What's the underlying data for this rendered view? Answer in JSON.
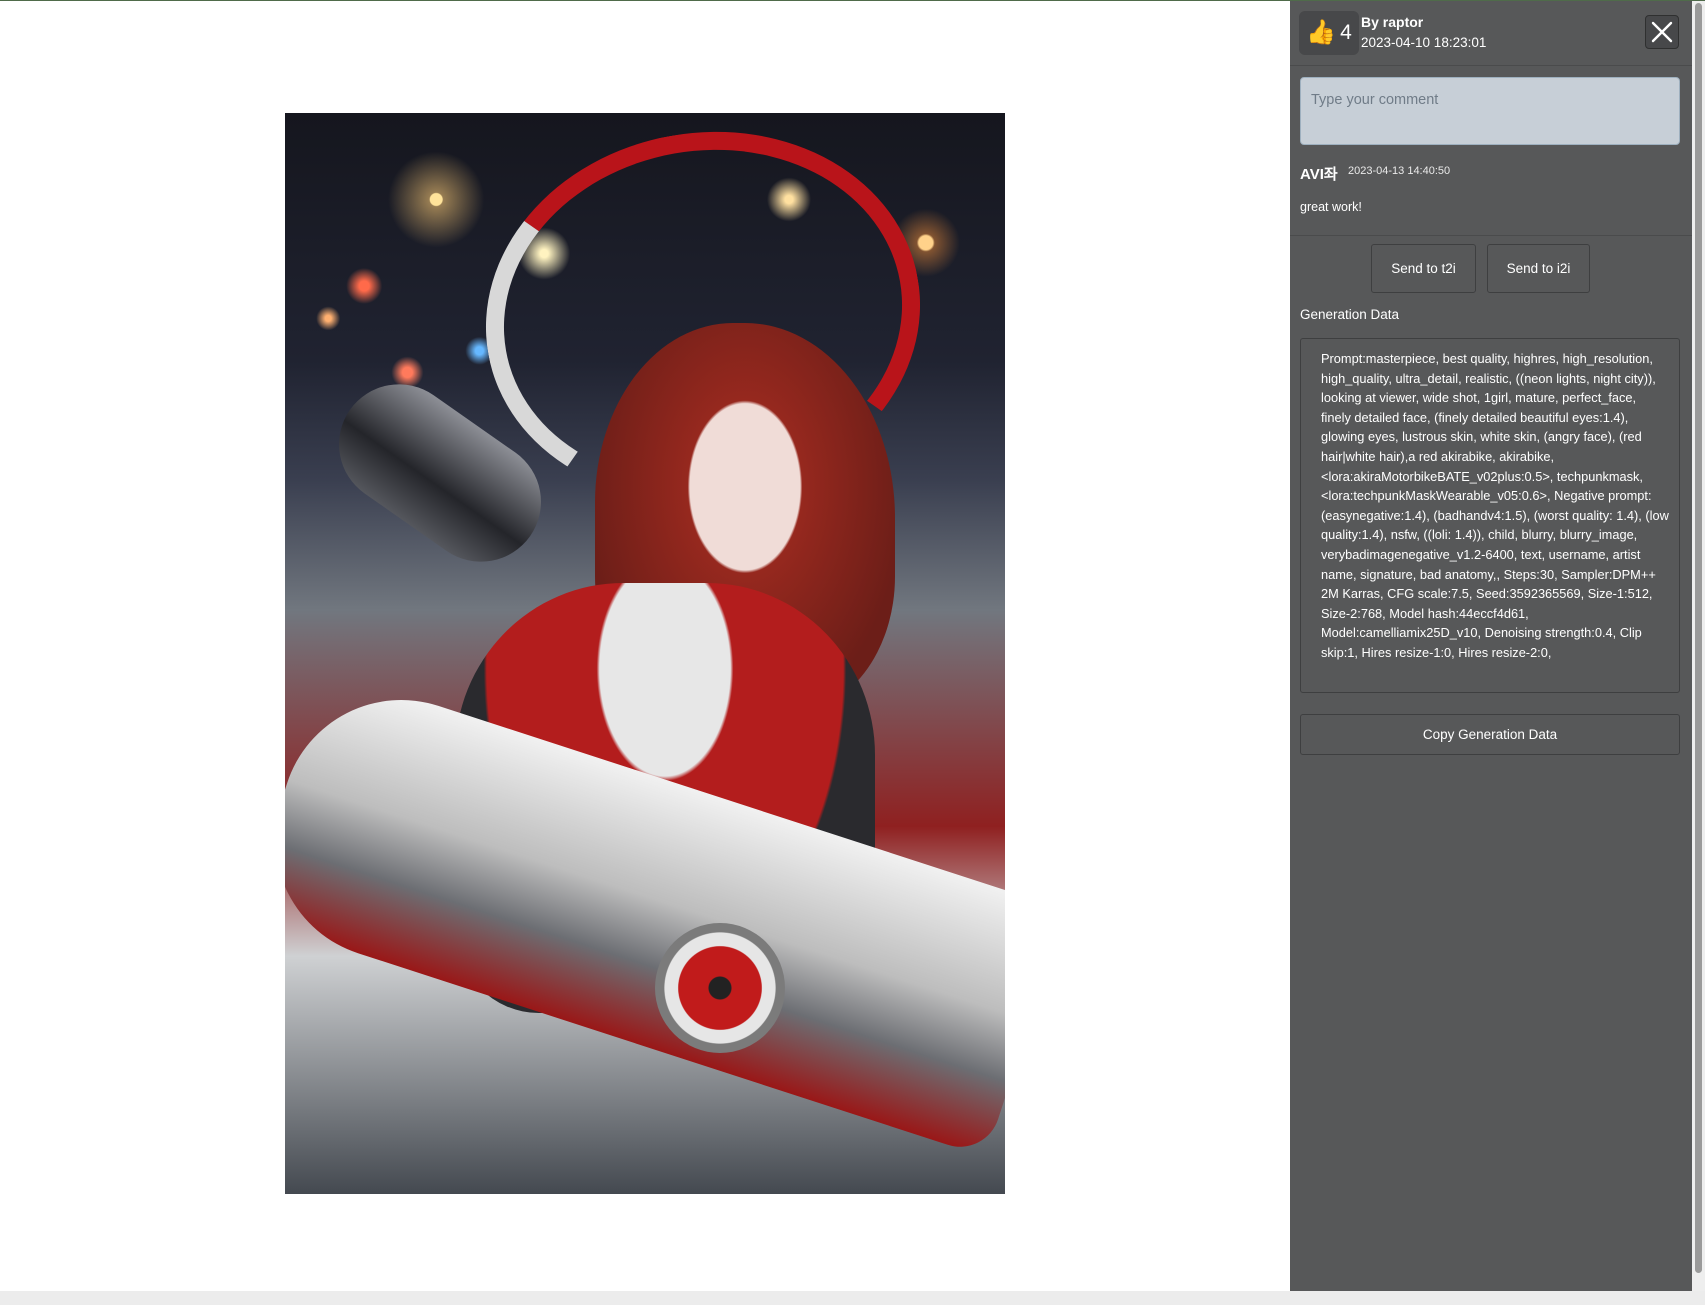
{
  "post": {
    "likes": "4",
    "author": "By raptor",
    "datetime": "2023-04-10 18:23:01"
  },
  "comment_input": {
    "placeholder": "Type your comment"
  },
  "comments": [
    {
      "user": "AVI좌",
      "datetime": "2023-04-13 14:40:50",
      "text": "great work!"
    }
  ],
  "actions": {
    "send_t2i": "Send to t2i",
    "send_i2i": "Send to i2i",
    "copy": "Copy Generation Data"
  },
  "generation": {
    "label": "Generation Data",
    "text": "Prompt:masterpiece, best quality, highres, high_resolution, high_quality, ultra_detail, realistic, ((neon lights, night city)), looking at viewer, wide shot, 1girl, mature, perfect_face, finely detailed face, (finely detailed beautiful eyes:1.4), glowing eyes, lustrous skin, white skin, (angry face), (red hair|white hair),a red akirabike, akirabike, <lora:akiraMotorbikeBATE_v02plus:0.5>, techpunkmask, <lora:techpunkMaskWearable_v05:0.6>, Negative prompt:(easynegative:1.4), (badhandv4:1.5), (worst quality: 1.4), (low quality:1.4), nsfw, ((loli: 1.4)), child, blurry, blurry_image, verybadimagenegative_v1.2-6400, text, username, artist name, signature, bad anatomy,, Steps:30, Sampler:DPM++ 2M Karras, CFG scale:7.5, Seed:3592365569, Size-1:512, Size-2:768, Model hash:44eccf4d61, Model:camelliamix25D_v10, Denoising strength:0.4, Clip skip:1, Hires resize-1:0, Hires resize-2:0,"
  },
  "icons": {
    "like": "thumbs-up-icon",
    "close": "close-icon"
  },
  "colors": {
    "sidebar_bg": "#575859",
    "input_bg": "#c7cfd7"
  }
}
